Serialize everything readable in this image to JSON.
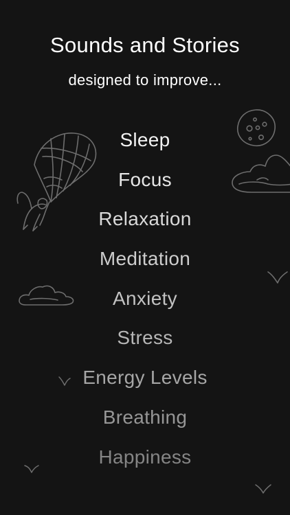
{
  "header": {
    "title": "Sounds and Stories",
    "subtitle": "designed to improve..."
  },
  "benefits": [
    {
      "label": "Sleep"
    },
    {
      "label": "Focus"
    },
    {
      "label": "Relaxation"
    },
    {
      "label": "Meditation"
    },
    {
      "label": "Anxiety"
    },
    {
      "label": "Stress"
    },
    {
      "label": "Energy Levels"
    },
    {
      "label": "Breathing"
    },
    {
      "label": "Happiness"
    }
  ],
  "colors": {
    "background": "#141414",
    "title_text": "#ffffff",
    "illustration_stroke": "#6e6e6e"
  },
  "illustrations": [
    "hot-air-balloon-icon",
    "moon-icon",
    "cloud-icon",
    "bird-icon"
  ]
}
